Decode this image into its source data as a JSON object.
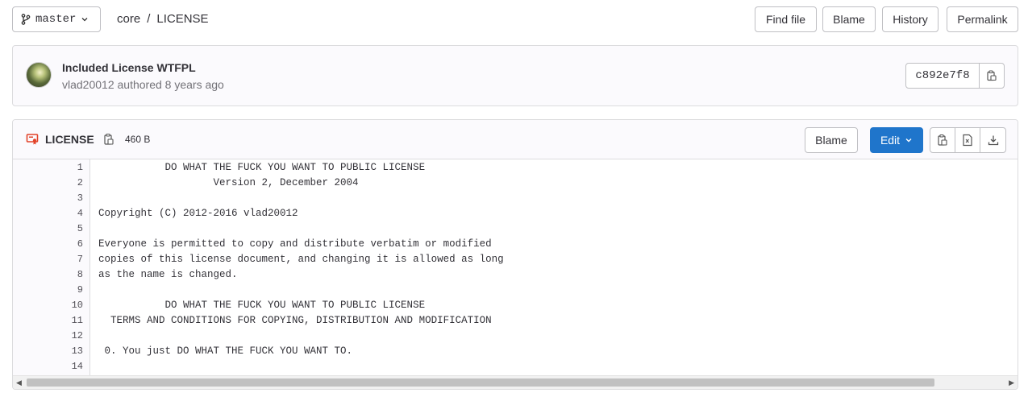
{
  "branch": {
    "name": "master",
    "icon": "branch-icon"
  },
  "breadcrumb": {
    "project": "core",
    "separator": "/",
    "file": "LICENSE"
  },
  "toolbar": {
    "find_file": "Find file",
    "blame": "Blame",
    "history": "History",
    "permalink": "Permalink"
  },
  "commit": {
    "title": "Included License WTFPL",
    "meta": "vlad20012 authored 8 years ago",
    "sha": "c892e7f8"
  },
  "file": {
    "name": "LICENSE",
    "size": "460 B",
    "blame": "Blame",
    "edit": "Edit",
    "lines": [
      {
        "n": "1",
        "text": "           DO WHAT THE FUCK YOU WANT TO PUBLIC LICENSE"
      },
      {
        "n": "2",
        "text": "                   Version 2, December 2004"
      },
      {
        "n": "3",
        "text": ""
      },
      {
        "n": "4",
        "text": "Copyright (C) 2012-2016 vlad20012"
      },
      {
        "n": "5",
        "text": ""
      },
      {
        "n": "6",
        "text": "Everyone is permitted to copy and distribute verbatim or modified"
      },
      {
        "n": "7",
        "text": "copies of this license document, and changing it is allowed as long"
      },
      {
        "n": "8",
        "text": "as the name is changed."
      },
      {
        "n": "9",
        "text": ""
      },
      {
        "n": "10",
        "text": "           DO WHAT THE FUCK YOU WANT TO PUBLIC LICENSE"
      },
      {
        "n": "11",
        "text": "  TERMS AND CONDITIONS FOR COPYING, DISTRIBUTION AND MODIFICATION"
      },
      {
        "n": "12",
        "text": ""
      },
      {
        "n": "13",
        "text": " 0. You just DO WHAT THE FUCK YOU WANT TO."
      },
      {
        "n": "14",
        "text": ""
      }
    ]
  },
  "colors": {
    "primary": "#1f75cb",
    "file_icon": "#e24329"
  }
}
